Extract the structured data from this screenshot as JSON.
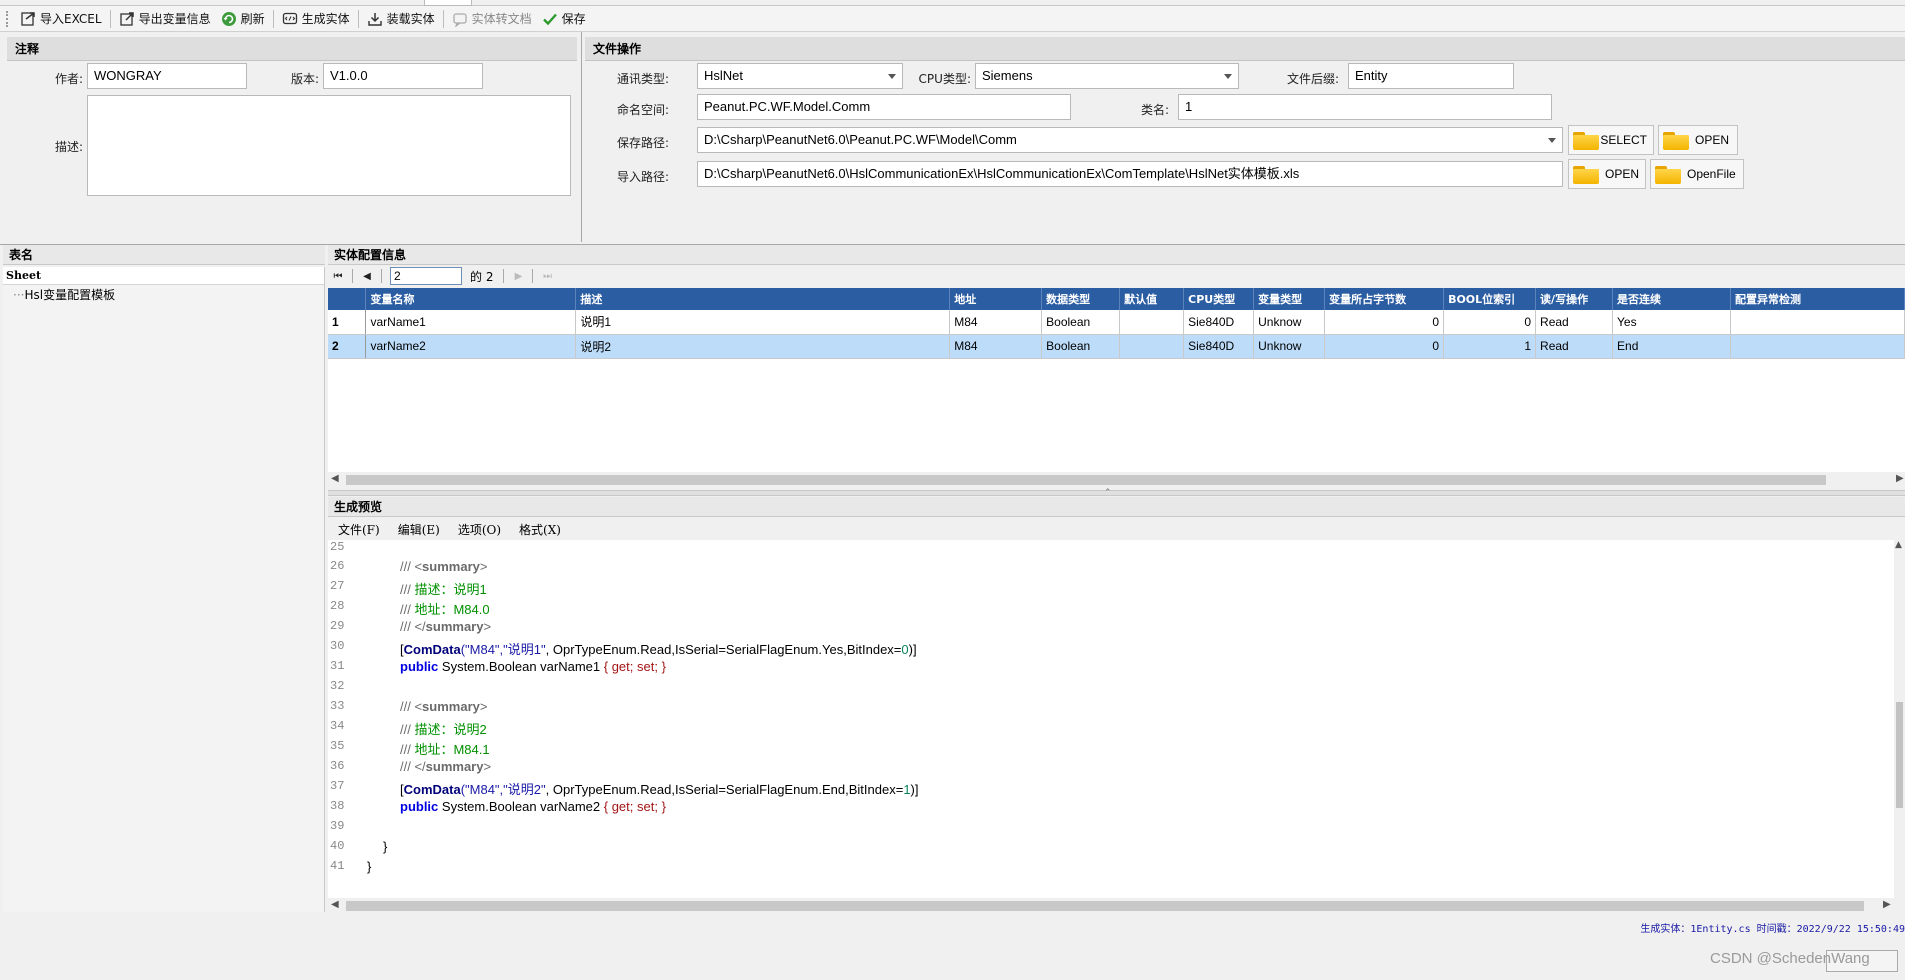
{
  "toolbar": {
    "items": [
      {
        "label": "导入EXCEL",
        "icon": "import-excel-icon"
      },
      {
        "label": "导出变量信息",
        "icon": "export-icon"
      },
      {
        "label": "刷新",
        "icon": "refresh-icon"
      },
      {
        "label": "生成实体",
        "icon": "generate-icon"
      },
      {
        "label": "装载实体",
        "icon": "load-icon"
      },
      {
        "label": "实体转文档",
        "icon": "doc-icon",
        "disabled": true
      },
      {
        "label": "保存",
        "icon": "check-icon"
      }
    ]
  },
  "annotation": {
    "title": "注释",
    "author_label": "作者:",
    "author": "WONGRAY",
    "version_label": "版本:",
    "version": "V1.0.0",
    "desc_label": "描述:",
    "desc": ""
  },
  "file_ops": {
    "title": "文件操作",
    "comm_type_label": "通讯类型:",
    "comm_type": "HslNet",
    "cpu_type_label": "CPU类型:",
    "cpu_type": "Siemens",
    "suffix_label": "文件后缀:",
    "suffix": "Entity",
    "namespace_label": "命名空间:",
    "namespace": "Peanut.PC.WF.Model.Comm",
    "class_label": "类名:",
    "class_name": "1",
    "save_path_label": "保存路径:",
    "save_path": "D:\\Csharp\\PeanutNet6.0\\Peanut.PC.WF\\Model\\Comm",
    "import_path_label": "导入路径:",
    "import_path": "D:\\Csharp\\PeanutNet6.0\\HslCommunicationEx\\HslCommunicationEx\\ComTemplate\\HslNet实体模板.xls",
    "btn_select": "SELECT",
    "btn_open": "OPEN",
    "btn_open2": "OPEN",
    "btn_openfile": "OpenFile"
  },
  "tables_panel": {
    "title": "表名",
    "root": "Sheet",
    "node": "Hsl变量配置模板"
  },
  "entity_panel": {
    "title": "实体配置信息",
    "page": "2",
    "total": "的 2",
    "columns": [
      "变量名称",
      "描述",
      "地址",
      "数据类型",
      "默认值",
      "CPU类型",
      "变量类型",
      "变量所占字节数",
      "BOOL位索引",
      "读/写操作",
      "是否连续",
      "配置异常检测"
    ],
    "rows": [
      {
        "no": "1",
        "cells": [
          "varName1",
          "说明1",
          "M84",
          "Boolean",
          "",
          "Sie840D",
          "Unknow",
          "0",
          "0",
          "Read",
          "Yes",
          ""
        ]
      },
      {
        "no": "2",
        "cells": [
          "varName2",
          "说明2",
          "M84",
          "Boolean",
          "",
          "Sie840D",
          "Unknow",
          "0",
          "1",
          "Read",
          "End",
          ""
        ]
      }
    ]
  },
  "preview": {
    "title": "生成预览",
    "menus": [
      "文件(F)",
      "编辑(E)",
      "选项(O)",
      "格式(X)"
    ],
    "line_numbers": [
      "25",
      "26",
      "27",
      "28",
      "29",
      "30",
      "31",
      "32",
      "33",
      "34",
      "35",
      "36",
      "37",
      "38",
      "39",
      "40",
      "41"
    ],
    "code": {
      "l26_a": "/// <",
      "l26_b": "summary",
      "l26_c": ">",
      "l27_a": "/// ",
      "l27_b": "描述：说明1",
      "l28_a": "/// ",
      "l28_b": "地址：M84.0",
      "l29_a": "/// </",
      "l29_b": "summary",
      "l29_c": ">",
      "l30_a": "[",
      "l30_b": "ComData",
      "l30_c": "(\"M84\",\"说明1\"",
      "l30_d": ", OprTypeEnum.Read,IsSerial=SerialFlagEnum.Yes,BitIndex=",
      "l30_e": "0",
      "l30_f": ")]",
      "l31_a": "public",
      "l31_b": " System.Boolean varName1 ",
      "l31_c": "{ get; set; }",
      "l33_a": "/// <",
      "l33_b": "summary",
      "l33_c": ">",
      "l34_a": "/// ",
      "l34_b": "描述：说明2",
      "l35_a": "/// ",
      "l35_b": "地址：M84.1",
      "l36_a": "/// </",
      "l36_b": "summary",
      "l36_c": ">",
      "l37_a": "[",
      "l37_b": "ComData",
      "l37_c": "(\"M84\",\"说明2\"",
      "l37_d": ", OprTypeEnum.Read,IsSerial=SerialFlagEnum.End,BitIndex=",
      "l37_e": "1",
      "l37_f": ")]",
      "l38_a": "public",
      "l38_b": " System.Boolean varName2 ",
      "l38_c": "{ get; set; }",
      "l40": "}",
      "l41": "}"
    }
  },
  "status": "生成实体：1Entity.cs 时间戳：2022/9/22 15:50:49",
  "watermark": "CSDN @SchedenWang"
}
